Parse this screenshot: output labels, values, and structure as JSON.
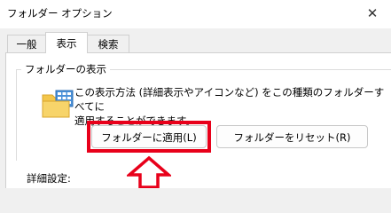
{
  "window": {
    "title": "フォルダー オプション",
    "close_symbol": "✕"
  },
  "tabs": [
    {
      "label": "一般",
      "selected": false
    },
    {
      "label": "表示",
      "selected": true
    },
    {
      "label": "検索",
      "selected": false
    }
  ],
  "folder_view": {
    "group_label": "フォルダーの表示",
    "icon": "folder-view-icon",
    "description_line1": "この表示方法 (詳細表示やアイコンなど) をこの種類のフォルダーすべてに",
    "description_line2": "適用することができます。",
    "apply_button": "フォルダーに適用(L)",
    "reset_button": "フォルダーをリセット(R)"
  },
  "advanced_settings_label": "詳細設定:",
  "annotation": {
    "highlight_color": "#e8001a",
    "arrow_icon": "up-arrow-outline-icon"
  }
}
